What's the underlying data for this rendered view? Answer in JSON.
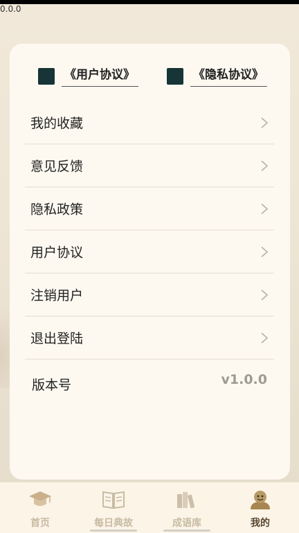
{
  "statusbar": {
    "version_corner": "0.0.0"
  },
  "agreements": {
    "user_agreement": "《用户协议》",
    "privacy_agreement": "《隐私协议》"
  },
  "menu": {
    "items": [
      {
        "label": "我的收藏"
      },
      {
        "label": "意见反馈"
      },
      {
        "label": "隐私政策"
      },
      {
        "label": "用户协议"
      },
      {
        "label": "注销用户"
      },
      {
        "label": "退出登陆"
      }
    ],
    "version_label": "版本号",
    "version_value": "v1.0.0"
  },
  "tabs": [
    {
      "label": "首页",
      "icon": "graduation-cap-icon"
    },
    {
      "label": "每日典故",
      "icon": "open-book-icon"
    },
    {
      "label": "成语库",
      "icon": "bookshelf-icon"
    },
    {
      "label": "我的",
      "icon": "user-icon",
      "active": true
    }
  ],
  "colors": {
    "checkbox": "#173436",
    "tab_inactive": "#c9bba3",
    "tab_active": "#5a4630",
    "accent_gold": "#a88652"
  }
}
